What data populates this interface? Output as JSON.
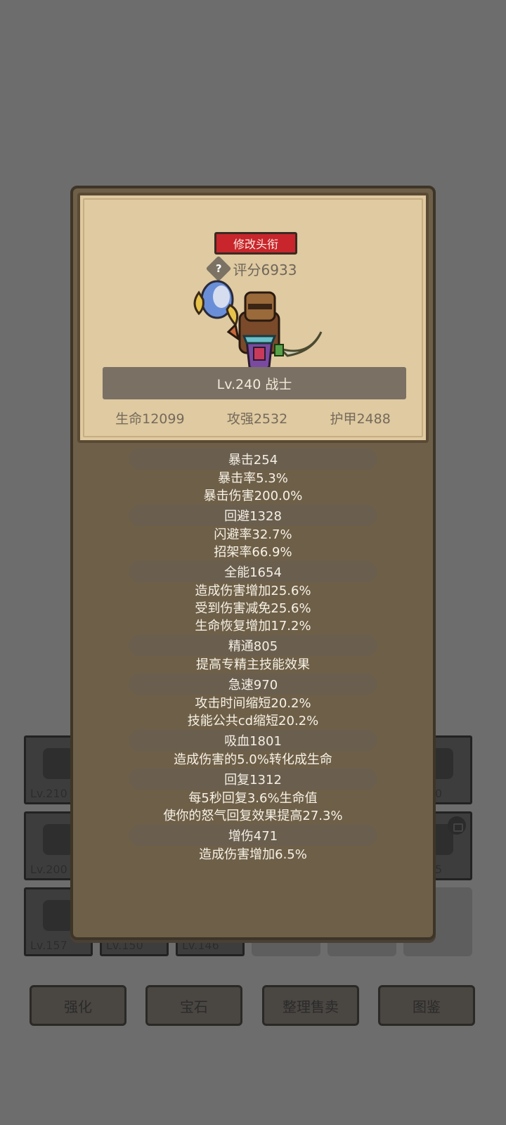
{
  "inventory": {
    "slots": [
      {
        "level": "Lv.210"
      },
      {
        "level": "200"
      },
      {
        "level": "Lv.200"
      },
      {
        "level": "65"
      },
      {
        "level": "Lv.157"
      },
      {
        "level": "Lv.150"
      },
      {
        "level": "Lv.146"
      }
    ],
    "buttons": [
      "强化",
      "宝石",
      "整理售卖",
      "图鉴"
    ]
  },
  "profile": {
    "title_button": "修改头衔",
    "score": "评分6933",
    "level_class": "Lv.240 战士",
    "base_stats": [
      "生命12099",
      "攻强2532",
      "护甲2488"
    ]
  },
  "stat_groups": [
    {
      "header": "暴击254",
      "lines": [
        "暴击率5.3%",
        "暴击伤害200.0%"
      ]
    },
    {
      "header": "回避1328",
      "lines": [
        "闪避率32.7%",
        "招架率66.9%"
      ]
    },
    {
      "header": "全能1654",
      "lines": [
        "造成伤害增加25.6%",
        "受到伤害减免25.6%",
        "生命恢复增加17.2%"
      ]
    },
    {
      "header": "精通805",
      "lines": [
        "提高专精主技能效果"
      ]
    },
    {
      "header": "急速970",
      "lines": [
        "攻击时间缩短20.2%",
        "技能公共cd缩短20.2%"
      ]
    },
    {
      "header": "吸血1801",
      "lines": [
        "造成伤害的5.0%转化成生命"
      ]
    },
    {
      "header": "回复1312",
      "lines": [
        "每5秒回复3.6%生命值",
        "使你的怒气回复效果提高27.3%"
      ]
    },
    {
      "header": "增伤471",
      "lines": [
        "造成伤害增加6.5%"
      ]
    }
  ],
  "colors": {
    "accent_red": "#c8262c",
    "card": "#dfcaa1",
    "panel": "#6e5f48"
  }
}
